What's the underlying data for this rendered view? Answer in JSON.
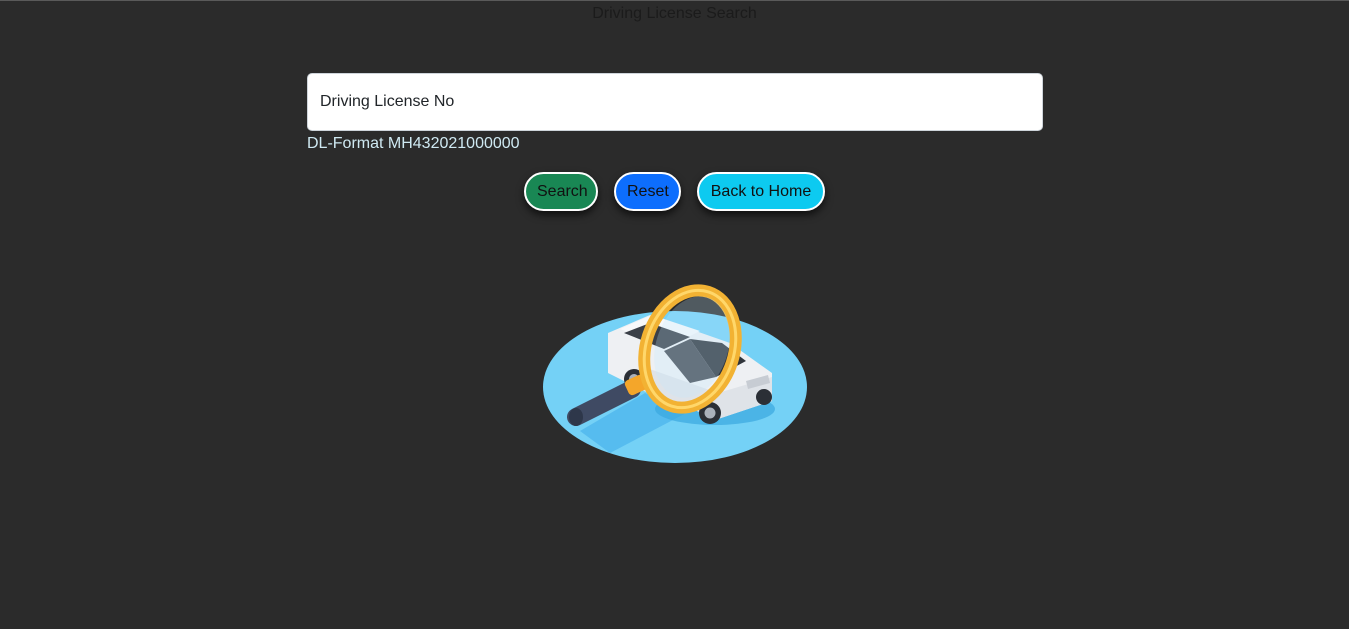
{
  "page": {
    "title": "Driving License Search"
  },
  "form": {
    "license_input": {
      "value": "",
      "placeholder": "Driving License No"
    },
    "format_hint": "DL-Format MH432021000000"
  },
  "buttons": {
    "search_label": "Search",
    "reset_label": "Reset",
    "home_label": "Back to Home"
  },
  "colors": {
    "background": "#2b2b2b",
    "search_button": "#198754",
    "reset_button": "#0d6efd",
    "home_button": "#0dcaf0",
    "hint_text": "#cfe9f2"
  },
  "illustration": {
    "icon": "car-search-illustration"
  }
}
